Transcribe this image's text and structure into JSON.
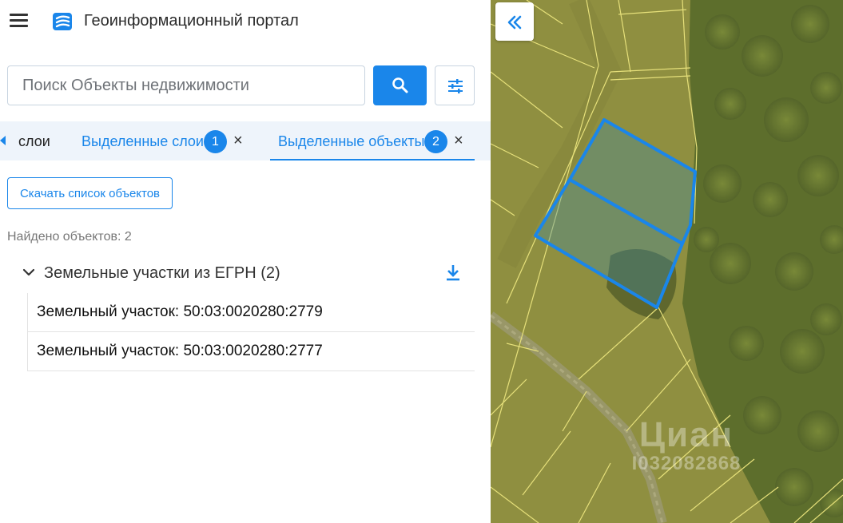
{
  "header": {
    "menu_icon": "hamburger-menu-icon",
    "logo_icon": "portal-logo-icon",
    "title": "Геоинформационный портал"
  },
  "search": {
    "value": "",
    "placeholder": "Поиск Объекты недвижимости",
    "search_icon": "search-icon",
    "filter_icon": "sliders-icon"
  },
  "tabs": [
    {
      "label": "слои",
      "badge": null,
      "closable": false,
      "active": false
    },
    {
      "label": "Выделенные слои",
      "badge": "1",
      "closable": true,
      "active": false
    },
    {
      "label": "Выделенные объекты",
      "badge": "2",
      "closable": true,
      "active": true
    }
  ],
  "tab_close_glyph": "×",
  "content": {
    "download_list_label": "Скачать список объектов",
    "found_text": "Найдено объектов: 2",
    "group": {
      "title": "Земельные участки из ЕГРН (2)",
      "expanded": true,
      "download_icon": "download-icon"
    },
    "results": [
      "Земельный участок: 50:03:0020280:2779",
      "Земельный участок: 50:03:0020280:2777"
    ]
  },
  "map": {
    "collapse_icon": "double-chevron-left-icon",
    "watermark_brand": "Циан",
    "watermark_id": "I032082868",
    "colors": {
      "highlight": "#1a86ea",
      "parcel_lines": "#e6e07a",
      "terrain": "#8a8a3a",
      "forest": "#5d6e2c"
    }
  },
  "colors": {
    "accent": "#1a86ea",
    "tab_bar_bg": "#eef4fb",
    "border": "#c8d4e0"
  }
}
